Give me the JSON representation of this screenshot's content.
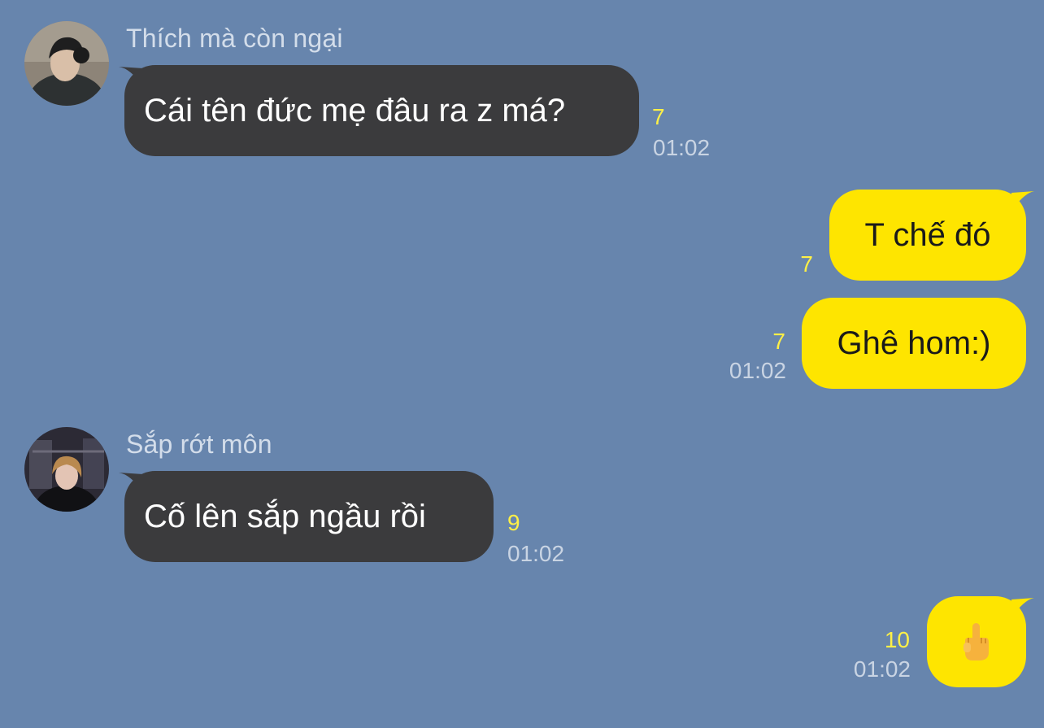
{
  "theme": {
    "background": "#6785ad",
    "incoming_bubble": "#3b3b3d",
    "outgoing_bubble": "#fee500",
    "unread_color": "#fef046",
    "time_color": "#c9d4e3"
  },
  "messages": [
    {
      "sender": "Thích mà còn ngại",
      "text": "Cái tên đức mẹ đâu ra z má?",
      "unread": "7",
      "time": "01:02",
      "direction": "incoming"
    },
    {
      "text": "T chế đó",
      "unread": "7",
      "time": "",
      "direction": "outgoing"
    },
    {
      "text": "Ghê hom:)",
      "unread": "7",
      "time": "01:02",
      "direction": "outgoing"
    },
    {
      "sender": "Sắp rớt môn",
      "text": "Cố lên sắp ngầu rồi",
      "unread": "9",
      "time": "01:02",
      "direction": "incoming"
    },
    {
      "emoji": "middle-finger-emoji",
      "unread": "10",
      "time": "01:02",
      "direction": "outgoing"
    }
  ]
}
